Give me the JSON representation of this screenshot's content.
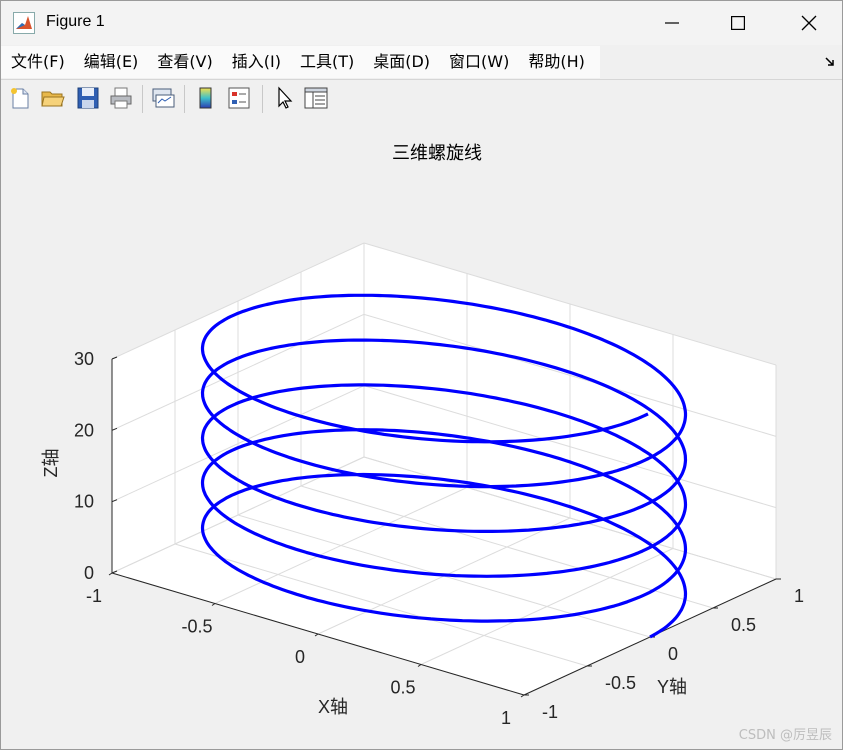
{
  "window": {
    "title": "Figure 1"
  },
  "menu": [
    "文件(F)",
    "编辑(E)",
    "查看(V)",
    "插入(I)",
    "工具(T)",
    "桌面(D)",
    "窗口(W)",
    "帮助(H)"
  ],
  "toolbar": [
    "new-figure-icon",
    "open-folder-icon",
    "save-icon",
    "print-icon",
    "link-plot-icon",
    "colorbar-icon",
    "legend-icon",
    "pointer-icon",
    "property-editor-icon"
  ],
  "chart_data": {
    "type": "line",
    "dimension": "3d",
    "title": "三维螺旋线",
    "xlabel": "X轴",
    "ylabel": "Y轴",
    "zlabel": "Z轴",
    "xlim": [
      -1,
      1
    ],
    "ylim": [
      -1,
      1
    ],
    "zlim": [
      0,
      30
    ],
    "xticks": [
      "-1",
      "-0.5",
      "0",
      "0.5",
      "1"
    ],
    "yticks": [
      "-1",
      "-0.5",
      "0",
      "0.5",
      "1"
    ],
    "zticks": [
      "0",
      "10",
      "20",
      "30"
    ],
    "grid": true,
    "series": [
      {
        "color": "#0000ff",
        "x": "cos(t)",
        "y": "sin(t)",
        "z": "t",
        "t_range": [
          0,
          31.4
        ]
      }
    ]
  },
  "watermark": "CSDN @厉昱辰"
}
